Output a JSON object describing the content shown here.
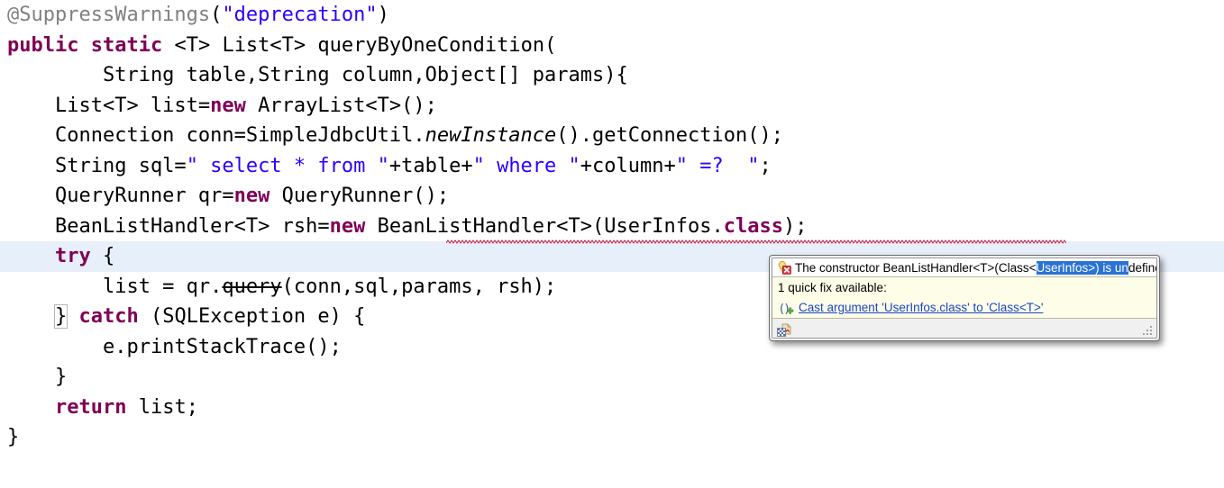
{
  "editor": {
    "language": "java",
    "current_line_index": 8,
    "colors": {
      "keyword": "#7f0055",
      "string": "#2a00ff",
      "annotation": "#808080",
      "plain": "#000000",
      "current_line_highlight": "#e7effa",
      "error_squiggle": "#c8143c",
      "selection": "#2a72d4",
      "link": "#1a45c8",
      "popup_body": "#fdfde8",
      "popup_message_bg": "#ffffff",
      "popup_footer_bg": "#f0f0f0"
    },
    "lines": [
      {
        "id": "line-annotation",
        "indent": 32,
        "tokens": [
          {
            "text": "@SuppressWarnings",
            "style": "anno"
          },
          {
            "text": "(",
            "style": "plain"
          },
          {
            "text": "\"deprecation\"",
            "style": "str"
          },
          {
            "text": ")",
            "style": "plain"
          }
        ]
      },
      {
        "id": "line-method-signature",
        "indent": 32,
        "tokens": [
          {
            "text": "public",
            "style": "kw"
          },
          {
            "text": " ",
            "style": "plain"
          },
          {
            "text": "static",
            "style": "kw"
          },
          {
            "text": " <T> List<T> queryByOneCondition(",
            "style": "plain"
          }
        ]
      },
      {
        "id": "line-method-params",
        "indent": 32,
        "tokens": [
          {
            "text": "        String table,String column,Object[] params){",
            "style": "plain"
          }
        ]
      },
      {
        "id": "line-list-decl",
        "indent": 32,
        "tokens": [
          {
            "text": "    List<T> list=",
            "style": "plain"
          },
          {
            "text": "new",
            "style": "kw"
          },
          {
            "text": " ArrayList<T>();",
            "style": "plain"
          }
        ]
      },
      {
        "id": "line-connection",
        "indent": 32,
        "tokens": [
          {
            "text": "    Connection conn=SimpleJdbcUtil.",
            "style": "plain"
          },
          {
            "text": "newInstance",
            "style": "italic"
          },
          {
            "text": "().getConnection();",
            "style": "plain"
          }
        ]
      },
      {
        "id": "line-sql",
        "indent": 32,
        "tokens": [
          {
            "text": "    String sql=",
            "style": "plain"
          },
          {
            "text": "\" select * from \"",
            "style": "str"
          },
          {
            "text": "+table+",
            "style": "plain"
          },
          {
            "text": "\" where \"",
            "style": "str"
          },
          {
            "text": "+column+",
            "style": "plain"
          },
          {
            "text": "\" =?  \"",
            "style": "str"
          },
          {
            "text": ";",
            "style": "plain"
          }
        ]
      },
      {
        "id": "line-queryrunner",
        "indent": 32,
        "tokens": [
          {
            "text": "    QueryRunner qr=",
            "style": "plain"
          },
          {
            "text": "new",
            "style": "kw"
          },
          {
            "text": " QueryRunner();",
            "style": "plain"
          }
        ]
      },
      {
        "id": "line-beanlisthandler",
        "indent": 32,
        "tokens": [
          {
            "text": "    BeanListHandler<T> rsh=",
            "style": "plain"
          },
          {
            "text": "new",
            "style": "kw"
          },
          {
            "text": " BeanListHandler<T>(UserInfos.",
            "style": "plain"
          },
          {
            "text": "class",
            "style": "kw"
          },
          {
            "text": ");",
            "style": "plain"
          }
        ],
        "has_error_squiggle": true
      },
      {
        "id": "line-try",
        "indent": 32,
        "is_current": true,
        "tokens": [
          {
            "text": "    ",
            "style": "plain"
          },
          {
            "text": "try",
            "style": "kw"
          },
          {
            "text": " {",
            "style": "plain"
          }
        ]
      },
      {
        "id": "line-query-call",
        "indent": 32,
        "tokens": [
          {
            "text": "        list = qr.",
            "style": "plain"
          },
          {
            "text": "query",
            "style": "struck"
          },
          {
            "text": "(conn,sql,params, rsh);",
            "style": "plain"
          }
        ]
      },
      {
        "id": "line-catch",
        "indent": 32,
        "tokens": [
          {
            "text": "    ",
            "style": "plain"
          },
          {
            "text": "}",
            "style": "bracketbox"
          },
          {
            "text": " ",
            "style": "plain"
          },
          {
            "text": "catch",
            "style": "kw"
          },
          {
            "text": " (SQLException e) {",
            "style": "plain"
          }
        ]
      },
      {
        "id": "line-printstacktrace",
        "indent": 32,
        "tokens": [
          {
            "text": "        e.printStackTrace();",
            "style": "plain"
          }
        ]
      },
      {
        "id": "line-close-catch",
        "indent": 32,
        "tokens": [
          {
            "text": "    }",
            "style": "plain"
          }
        ]
      },
      {
        "id": "line-return",
        "indent": 32,
        "tokens": [
          {
            "text": "    ",
            "style": "plain"
          },
          {
            "text": "return",
            "style": "kw"
          },
          {
            "text": " list;",
            "style": "plain"
          }
        ]
      },
      {
        "id": "line-close-method",
        "indent": 32,
        "tokens": [
          {
            "text": "}",
            "style": "plain"
          }
        ]
      }
    ]
  },
  "popup": {
    "name": "quick-fix-hover-popup",
    "message": {
      "icon": "error-bulb-icon",
      "prefix": "The constructor BeanListHandler<T>(Class<",
      "selected": "UserInfos>) is un",
      "suffix": "defined",
      "full_text": "The constructor BeanListHandler<T>(Class<UserInfos>) is undefined"
    },
    "subtitle": "1 quick fix available:",
    "quick_fixes": [
      {
        "icon": "cast-argument-icon",
        "label": "Cast argument 'UserInfos.class' to 'Class<T>'"
      }
    ],
    "footer": {
      "icon": "configure-annotations-icon",
      "resize_grip": "resize-grip"
    }
  }
}
